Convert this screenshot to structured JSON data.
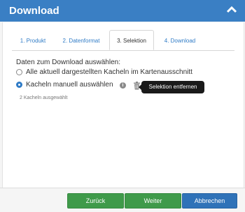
{
  "header": {
    "title": "Download",
    "collapse_icon": "chevron-up-icon",
    "color": "#3a7fc4"
  },
  "tabs": [
    {
      "label": "1. Produkt"
    },
    {
      "label": "2. Datenformat"
    },
    {
      "label": "3. Selektion",
      "active": true
    },
    {
      "label": "4. Download"
    }
  ],
  "selection": {
    "lead": "Daten zum Download auswählen:",
    "options": [
      {
        "label": "Alle aktuell dargestellten Kacheln im Kartenausschnitt",
        "checked": false
      },
      {
        "label": "Kacheln manuell auswählen",
        "checked": true
      }
    ],
    "info_icon": "info-icon",
    "trash_icon": "trash-icon",
    "tooltip": "Selektion entfernen",
    "count_text": "2 Kacheln ausgewählt"
  },
  "footer": {
    "back_label": "Zurück",
    "next_label": "Weiter",
    "cancel_label": "Abbrechen",
    "green": "#3f9a4a",
    "blue": "#2f72b8"
  }
}
